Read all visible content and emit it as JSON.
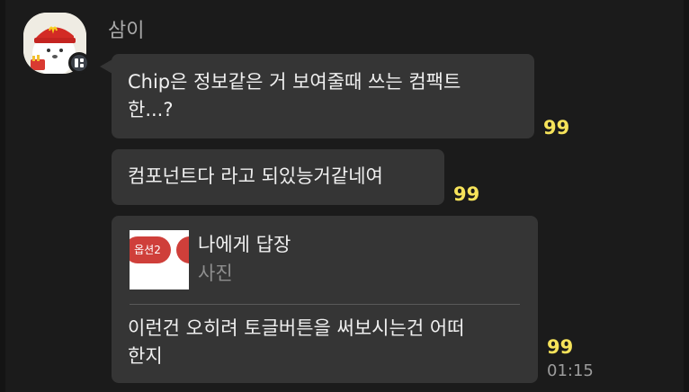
{
  "sender": {
    "name": "삼이"
  },
  "messages": [
    {
      "text_lines": [
        "Chip은 정보같은 거 보여줄때 쓰는 컴팩트",
        "한...?"
      ],
      "unread_count": "99"
    },
    {
      "text": "컴포넌트다 라고 되있능거같네여",
      "unread_count": "99"
    },
    {
      "reply": {
        "target": "나에게 답장",
        "media_type": "사진",
        "thumbnail_chips": [
          "옵션2",
          "옵"
        ]
      },
      "text_lines": [
        "이런건 오히려 토글버튼을 써보시는건 어떠",
        "한지"
      ],
      "unread_count": "99",
      "time": "01:15"
    }
  ],
  "colors": {
    "background": "#1b1b1b",
    "bubble": "#353535",
    "unread_count": "#f6e35a",
    "sender_name": "#a9a9a9",
    "thumbnail_chip": "#cf3f3a"
  },
  "icons": {
    "avatar": "mascot-avatar",
    "badge": "split-panel-icon"
  }
}
